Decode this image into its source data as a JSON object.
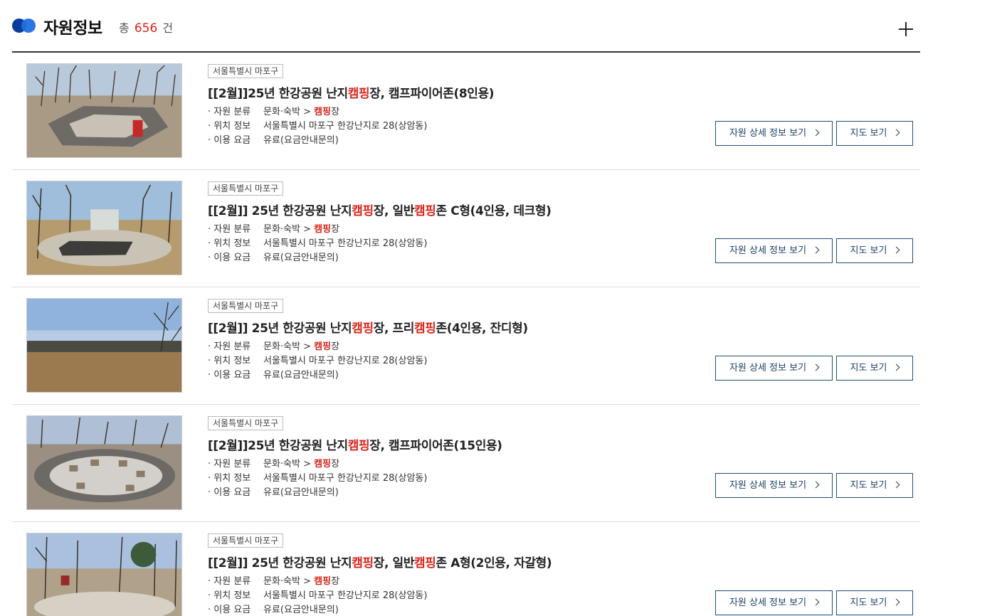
{
  "header": {
    "title": "자원정보",
    "count_prefix": "총",
    "count_value": "656",
    "count_suffix": "건"
  },
  "labels": {
    "category": "자원 분류",
    "location": "위치 정보",
    "fee": "이용 요금",
    "detail_button": "자원 상세 정보 보기",
    "map_button": "지도 보기"
  },
  "items": [
    {
      "region": "서울특별시 마포구",
      "title_parts": [
        "[[2월]]25년 한강공원 난지",
        "캠핑",
        "장, 캠프파이어존(8인용)"
      ],
      "category_prefix": "문화·숙박 > ",
      "category_hl": "캠핑",
      "category_suffix": "장",
      "location": "서울특별시 마포구 한강난지로 28(상암동)",
      "fee": "유료(요금안내문의)",
      "image": "campfire-zone-photo"
    },
    {
      "region": "서울특별시 마포구",
      "title_parts": [
        "[[2월]] 25년 한강공원 난지",
        "캠핑",
        "장, 일반",
        "캠핑",
        "존 C형(4인용, 데크형)"
      ],
      "category_prefix": "문화·숙박 > ",
      "category_hl": "캠핑",
      "category_suffix": "장",
      "location": "서울특별시 마포구 한강난지로 28(상암동)",
      "fee": "유료(요금안내문의)",
      "image": "deck-site-photo"
    },
    {
      "region": "서울특별시 마포구",
      "title_parts": [
        "[[2월]] 25년 한강공원 난지",
        "캠핑",
        "장, 프리",
        "캠핑",
        "존(4인용, 잔디형)"
      ],
      "category_prefix": "문화·숙박 > ",
      "category_hl": "캠핑",
      "category_suffix": "장",
      "location": "서울특별시 마포구 한강난지로 28(상암동)",
      "fee": "유료(요금안내문의)",
      "image": "lawn-field-photo"
    },
    {
      "region": "서울특별시 마포구",
      "title_parts": [
        "[[2월]]25년 한강공원 난지",
        "캠핑",
        "장, 캠프파이어존(15인용)"
      ],
      "category_prefix": "문화·숙박 > ",
      "category_hl": "캠핑",
      "category_suffix": "장",
      "location": "서울특별시 마포구 한강난지로 28(상암동)",
      "fee": "유료(요금안내문의)",
      "image": "campfire-circle-photo"
    },
    {
      "region": "서울특별시 마포구",
      "title_parts": [
        "[[2월]] 25년 한강공원 난지",
        "캠핑",
        "장, 일반",
        "캠핑",
        "존 A형(2인용, 자갈형)"
      ],
      "category_prefix": "문화·숙박 > ",
      "category_hl": "캠핑",
      "category_suffix": "장",
      "location": "서울특별시 마포구 한강난지로 28(상암동)",
      "fee": "유료(요금안내문의)",
      "image": "gravel-site-photo"
    }
  ],
  "colors": {
    "highlight": "#d9261c",
    "button_border": "#1d4e79",
    "dot_dark": "#0a3d9c",
    "dot_light": "#1f6fe0"
  }
}
